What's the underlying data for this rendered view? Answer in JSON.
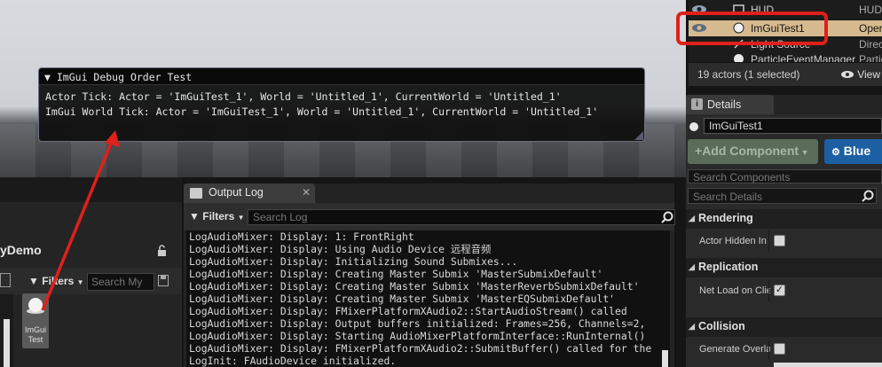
{
  "imgui": {
    "title": "ImGui Debug Order Test",
    "collapse_glyph": "▼",
    "lines": [
      "Actor Tick: Actor = 'ImGuiTest_1', World = 'Untitled_1', CurrentWorld = 'Untitled_1'",
      "ImGui World Tick: Actor = 'ImGuiTest_1', World = 'Untitled_1', CurrentWorld = 'Untitled_1'"
    ]
  },
  "outliner": {
    "rows": [
      {
        "name": "HUD",
        "type": "HUD",
        "icon": "hud-icon"
      },
      {
        "name": "ImGuiTest1",
        "type": "Oper",
        "icon": "sphere-icon",
        "selected": true
      },
      {
        "name": "Light Source",
        "type": "Direc",
        "icon": "light-icon"
      },
      {
        "name": "ParticleEventManager",
        "type": "Partic",
        "icon": "sphere-icon"
      }
    ],
    "status": "19 actors (1 selected)",
    "view_options": "View"
  },
  "details": {
    "tab": "Details",
    "actor_name": "ImGuiTest1",
    "add_component": "Add Component",
    "blueprint": "Blue",
    "search_components_placeholder": "Search Components",
    "search_details_placeholder": "Search Details",
    "categories": [
      {
        "name": "Rendering",
        "prop": "Actor Hidden In",
        "checked": false
      },
      {
        "name": "Replication",
        "prop": "Net Load on Clie",
        "checked": true
      },
      {
        "name": "Collision",
        "prop": "Generate Overla",
        "checked": false
      }
    ]
  },
  "output_log": {
    "tab": "Output Log",
    "filters": "Filters",
    "search_placeholder": "Search Log",
    "lines": [
      "LogAudioMixer: Display: 1: FrontRight",
      "LogAudioMixer: Display: Using Audio Device 远程音频",
      "LogAudioMixer: Display: Initializing Sound Submixes...",
      "LogAudioMixer: Display: Creating Master Submix 'MasterSubmixDefault'",
      "LogAudioMixer: Display: Creating Master Submix 'MasterReverbSubmixDefault'",
      "LogAudioMixer: Display: Creating Master Submix 'MasterEQSubmixDefault'",
      "LogAudioMixer: Display: FMixerPlatformXAudio2::StartAudioStream() called",
      "LogAudioMixer: Display: Output buffers initialized: Frames=256, Channels=2,",
      "LogAudioMixer: Display: Starting AudioMixerPlatformInterface::RunInternal()",
      "LogAudioMixer: Display: FMixerPlatformXAudio2::SubmitBuffer() called for the",
      "LogInit: FAudioDevice initialized."
    ]
  },
  "content_browser": {
    "title": "yDemo",
    "filters": "Filters",
    "search_placeholder": "Search My",
    "asset_label_line1": "ImGui",
    "asset_label_line2": "Test"
  },
  "colors": {
    "selection": "#d6ba8f",
    "highlight": "#e0201b",
    "blueprint": "#1d5fa3"
  }
}
